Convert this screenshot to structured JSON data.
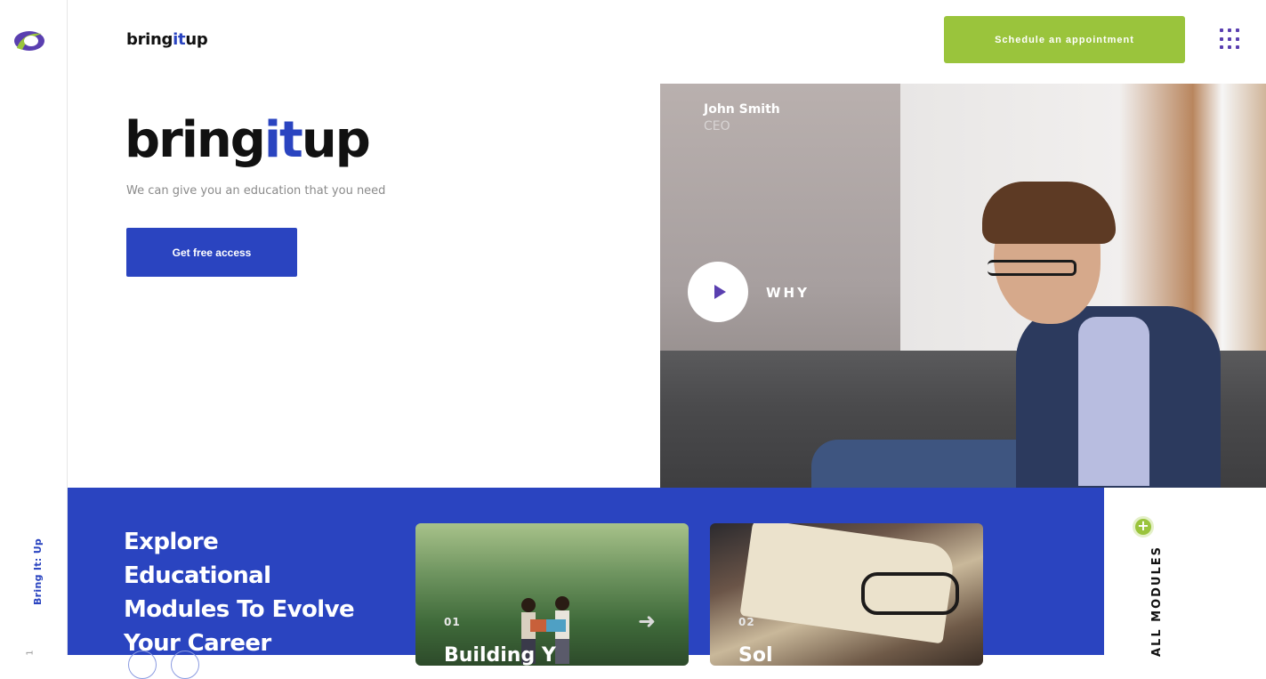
{
  "rail": {
    "logo_icon": "brand-logo-icon",
    "vertical_label": "Bring It: Up",
    "page_number": "1"
  },
  "header": {
    "brand_parts": [
      "bring",
      "it",
      "up"
    ],
    "cta_label": "Schedule an appointment",
    "menu_icon": "grid-menu-icon"
  },
  "hero": {
    "brand_parts": [
      "bring",
      "it",
      "up"
    ],
    "subtitle": "We can give you an education that you need",
    "cta_label": "Get free access",
    "person_name": "John Smith",
    "person_role": "CEO",
    "play_icon": "play-icon",
    "play_label": "WHY"
  },
  "modules": {
    "title": "Explore Educational Modules To Evolve Your Career",
    "cards": [
      {
        "number": "01",
        "title": "Building Y",
        "arrow_icon": "arrow-right-icon"
      },
      {
        "number": "02",
        "title": "Sol"
      }
    ],
    "all_modules_label": "ALL MODULES",
    "plus_icon": "plus-icon"
  },
  "colors": {
    "accent_blue": "#2a44c0",
    "accent_green": "#9ac43c",
    "accent_purple": "#5a3fb0"
  }
}
